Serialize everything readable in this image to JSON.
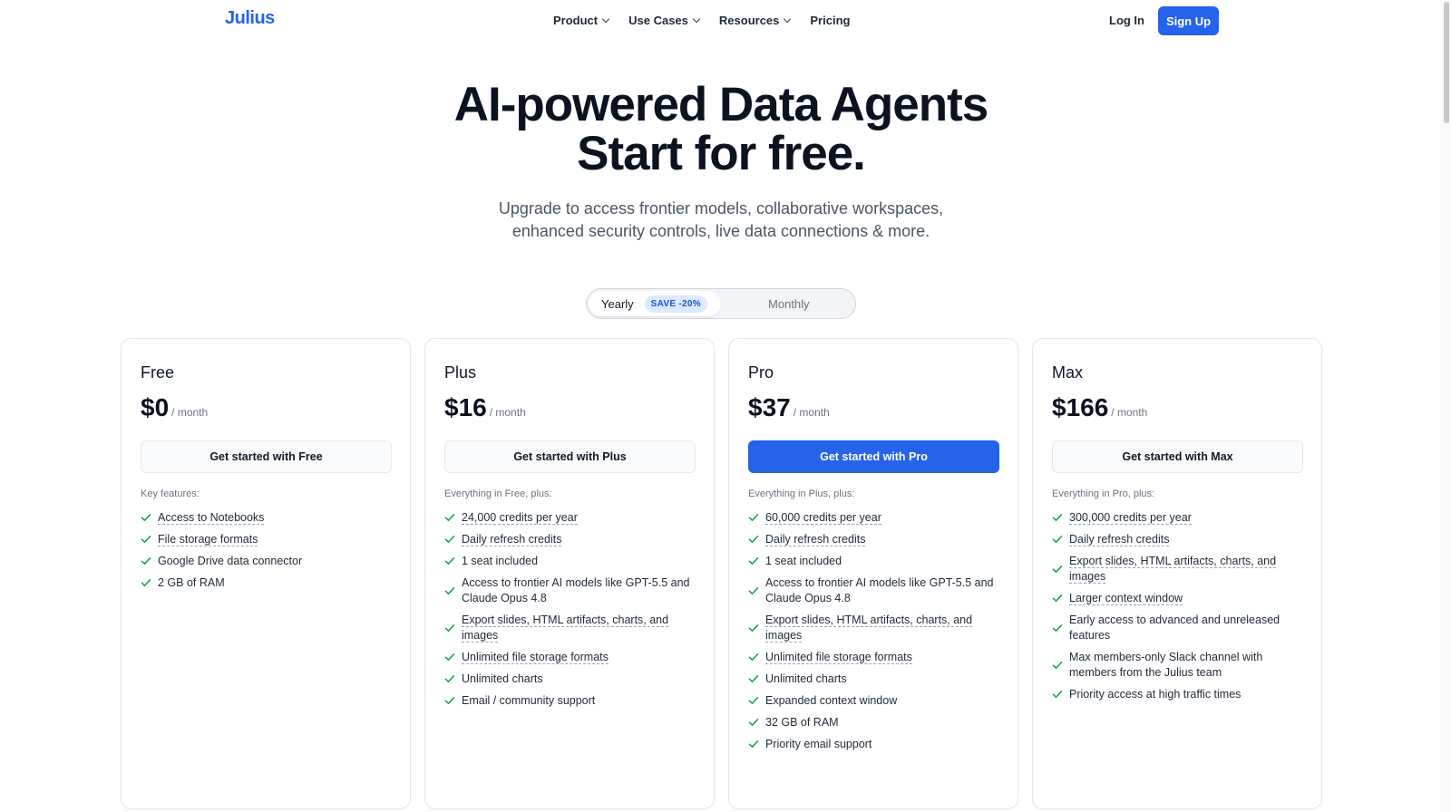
{
  "nav": {
    "logo": "Julius",
    "links": [
      {
        "label": "Product",
        "dropdown": true
      },
      {
        "label": "Use Cases",
        "dropdown": true
      },
      {
        "label": "Resources",
        "dropdown": true
      },
      {
        "label": "Pricing",
        "dropdown": false
      }
    ],
    "login": "Log In",
    "signup": "Sign Up"
  },
  "hero": {
    "title_line1": "AI-powered Data Agents",
    "title_line2": "Start for free.",
    "sub_line1": "Upgrade to access frontier models, collaborative workspaces,",
    "sub_line2": "enhanced security controls, live data connections & more."
  },
  "billing": {
    "yearly": "Yearly",
    "save": "SAVE -20%",
    "monthly": "Monthly",
    "selected": "Yearly"
  },
  "plans": [
    {
      "name": "Free",
      "price": "$0",
      "per": "/ month",
      "cta": "Get started with Free",
      "primary": false,
      "features_label": "Key features:",
      "features": [
        {
          "text": "Access to Notebooks",
          "dotted": true
        },
        {
          "text": "File storage formats",
          "dotted": true
        },
        {
          "text": "Google Drive data connector",
          "dotted": false
        },
        {
          "text": "2 GB of RAM",
          "dotted": false
        }
      ]
    },
    {
      "name": "Plus",
      "price": "$16",
      "per": "/ month",
      "cta": "Get started with Plus",
      "primary": false,
      "features_label": "Everything in Free, plus:",
      "features": [
        {
          "text": "24,000 credits per year",
          "dotted": true
        },
        {
          "text": "Daily refresh credits",
          "dotted": true
        },
        {
          "text": "1 seat included",
          "dotted": false
        },
        {
          "text": "Access to frontier AI models like GPT-5.5 and Claude Opus 4.8",
          "dotted": false
        },
        {
          "text": "Export slides, HTML artifacts, charts, and images",
          "dotted": true
        },
        {
          "text": "Unlimited file storage formats",
          "dotted": true
        },
        {
          "text": "Unlimited charts",
          "dotted": false
        },
        {
          "text": "Email / community support",
          "dotted": false
        }
      ]
    },
    {
      "name": "Pro",
      "price": "$37",
      "per": "/ month",
      "cta": "Get started with Pro",
      "primary": true,
      "features_label": "Everything in Plus, plus:",
      "features": [
        {
          "text": "60,000 credits per year",
          "dotted": true
        },
        {
          "text": "Daily refresh credits",
          "dotted": true
        },
        {
          "text": "1 seat included",
          "dotted": false
        },
        {
          "text": "Access to frontier AI models like GPT-5.5 and Claude Opus 4.8",
          "dotted": false
        },
        {
          "text": "Export slides, HTML artifacts, charts, and images",
          "dotted": true
        },
        {
          "text": "Unlimited file storage formats",
          "dotted": true
        },
        {
          "text": "Unlimited charts",
          "dotted": false
        },
        {
          "text": "Expanded context window",
          "dotted": false
        },
        {
          "text": "32 GB of RAM",
          "dotted": false
        },
        {
          "text": "Priority email support",
          "dotted": false
        }
      ]
    },
    {
      "name": "Max",
      "price": "$166",
      "per": "/ month",
      "cta": "Get started with Max",
      "primary": false,
      "features_label": "Everything in Pro, plus:",
      "features": [
        {
          "text": "300,000 credits per year",
          "dotted": true
        },
        {
          "text": "Daily refresh credits",
          "dotted": true
        },
        {
          "text": "Export slides, HTML artifacts, charts, and images",
          "dotted": true
        },
        {
          "text": "Larger context window",
          "dotted": true
        },
        {
          "text": "Early access to advanced and unreleased features",
          "dotted": false
        },
        {
          "text": "Max members-only Slack channel with members from the Julius team",
          "dotted": false
        },
        {
          "text": "Priority access at high traffic times",
          "dotted": false
        }
      ]
    }
  ],
  "colors": {
    "accent": "#2563eb",
    "check": "#16a34a",
    "badge_bg": "#dbeafe"
  },
  "icons": {
    "check": "check-icon",
    "chevron": "chevron-down-icon"
  }
}
